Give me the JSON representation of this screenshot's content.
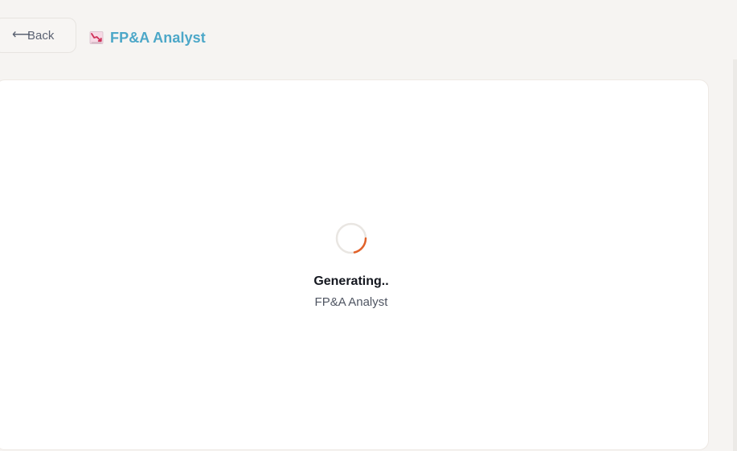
{
  "header": {
    "back_label": "Back",
    "back_icon": "left-arrow-icon",
    "app_icon": "chart-down-icon",
    "title": "FP&A Analyst"
  },
  "status": {
    "title": "Generating..",
    "subtitle": "FP&A Analyst"
  },
  "colors": {
    "background": "#f6f4f2",
    "title": "#4ca7c8",
    "loader": "#e2622a",
    "card": "#ffffff"
  }
}
